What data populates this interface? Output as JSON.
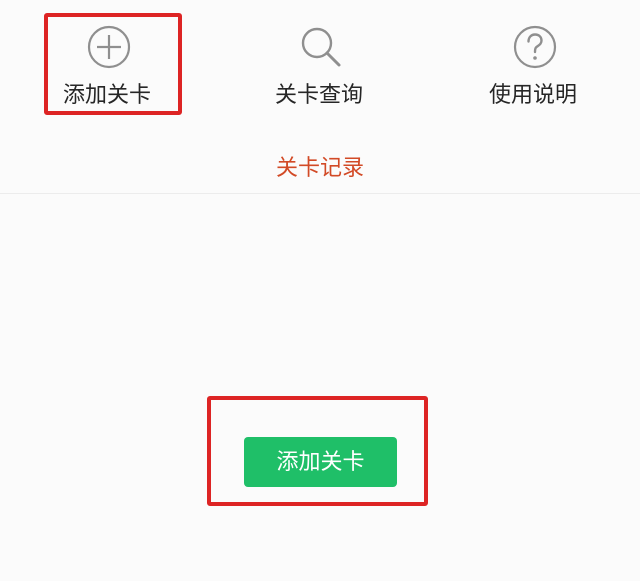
{
  "toolbar": {
    "items": [
      {
        "label": "添加关卡",
        "icon": "plus-circle-icon"
      },
      {
        "label": "关卡查询",
        "icon": "search-icon"
      },
      {
        "label": "使用说明",
        "icon": "help-circle-icon"
      }
    ]
  },
  "records": {
    "title": "关卡记录"
  },
  "main": {
    "add_button_label": "添加关卡"
  },
  "colors": {
    "title_accent": "#d24a26",
    "button": "#1fbf68",
    "highlight": "#dd2424"
  }
}
